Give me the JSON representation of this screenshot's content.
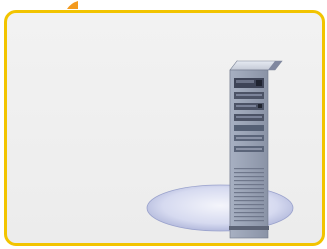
{
  "colors": {
    "frame_border": "#f2c400",
    "frame_fill": "#efefef",
    "accent_tab": "#f39a1e",
    "platform": "#c9cfea",
    "server_body": "#8f96a8"
  },
  "icons": {
    "main": "server-icon",
    "base": "platform-icon"
  }
}
